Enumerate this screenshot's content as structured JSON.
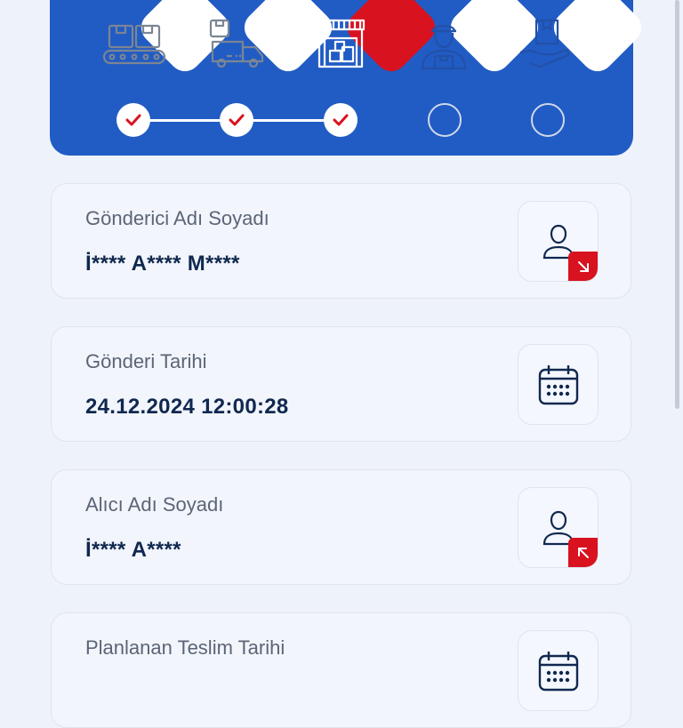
{
  "tracking": {
    "steps": [
      {
        "icon": "conveyor-boxes-icon",
        "completed": true,
        "active": false
      },
      {
        "icon": "delivery-truck-icon",
        "completed": true,
        "active": false
      },
      {
        "icon": "warehouse-icon",
        "completed": true,
        "active": true
      },
      {
        "icon": "courier-icon",
        "completed": false,
        "active": false
      },
      {
        "icon": "hand-package-icon",
        "completed": false,
        "active": false
      }
    ]
  },
  "cards": {
    "sender": {
      "label": "Gönderici Adı Soyadı",
      "value": "İ**** A**** M****",
      "icon": "sender-person-icon"
    },
    "ship_date": {
      "label": "Gönderi Tarihi",
      "value": "24.12.2024 12:00:28",
      "icon": "calendar-icon"
    },
    "receiver": {
      "label": "Alıcı Adı Soyadı",
      "value": "İ**** A****",
      "icon": "receiver-person-icon"
    },
    "planned_delivery": {
      "label": "Planlanan Teslim Tarihi",
      "value": "",
      "icon": "calendar-icon"
    }
  },
  "colors": {
    "primary": "#215cc4",
    "accent": "#d9121f",
    "text_dark": "#10284f",
    "text_muted": "#5b6576",
    "background": "#eef2fa"
  }
}
